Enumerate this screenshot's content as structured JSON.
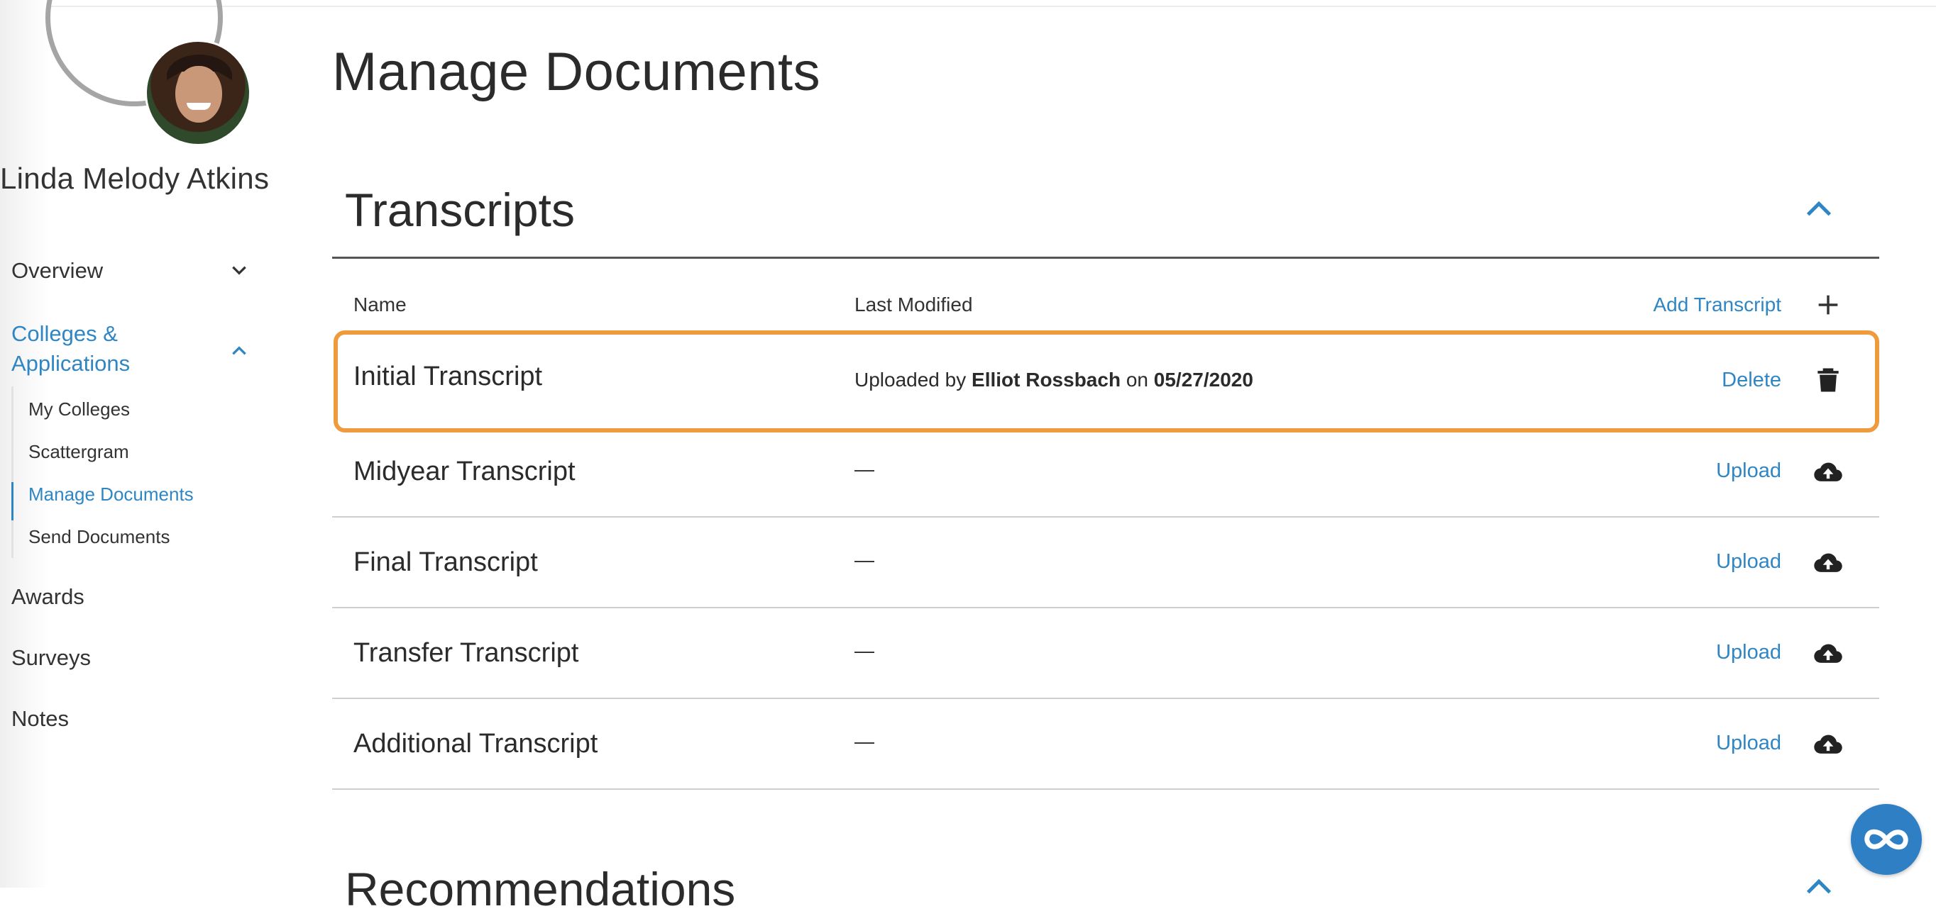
{
  "user": {
    "name": "Linda Melody Atkins"
  },
  "nav": {
    "overview": "Overview",
    "colleges": "Colleges & Applications",
    "sub": [
      "My Colleges",
      "Scattergram",
      "Manage Documents",
      "Send Documents"
    ],
    "awards": "Awards",
    "surveys": "Surveys",
    "notes": "Notes"
  },
  "page": {
    "title": "Manage Documents"
  },
  "transcripts": {
    "title": "Transcripts",
    "col_name": "Name",
    "col_modified": "Last Modified",
    "add_label": "Add Transcript",
    "rows": [
      {
        "name": "Initial Transcript",
        "uploaded_by_prefix": "Uploaded by",
        "uploader": "Elliot Rossbach",
        "on": "on",
        "date": "05/27/2020",
        "action": "Delete",
        "icon": "trash-icon"
      },
      {
        "name": "Midyear Transcript",
        "modified": "—",
        "action": "Upload",
        "icon": "cloud-upload-icon"
      },
      {
        "name": "Final Transcript",
        "modified": "—",
        "action": "Upload",
        "icon": "cloud-upload-icon"
      },
      {
        "name": "Transfer Transcript",
        "modified": "—",
        "action": "Upload",
        "icon": "cloud-upload-icon"
      },
      {
        "name": "Additional Transcript",
        "modified": "—",
        "action": "Upload",
        "icon": "cloud-upload-icon"
      }
    ]
  },
  "next_section": {
    "title": "Recommendations"
  },
  "colors": {
    "accent": "#2f86c4",
    "highlight": "#ee9a3d",
    "fab": "#2f7fc4"
  }
}
